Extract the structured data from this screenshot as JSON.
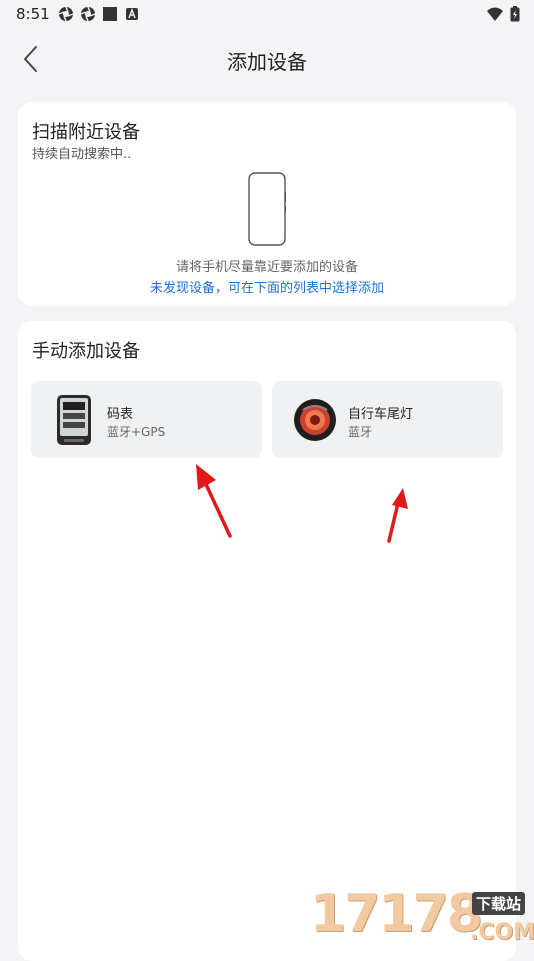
{
  "status_bar": {
    "time": "8:51"
  },
  "header": {
    "title": "添加设备"
  },
  "scan": {
    "title": "扫描附近设备",
    "subtitle": "持续自动搜索中..",
    "hint": "请将手机尽量靠近要添加的设备",
    "link": "未发现设备，可在下面的列表中选择添加"
  },
  "manual": {
    "title": "手动添加设备",
    "devices": [
      {
        "name": "码表",
        "type": "蓝牙+GPS",
        "icon": "bike-computer-icon"
      },
      {
        "name": "自行车尾灯",
        "type": "蓝牙",
        "icon": "tail-light-icon"
      }
    ]
  },
  "watermark": {
    "number": "17178",
    "suffix": "下载站",
    "domain": ".COM"
  },
  "colors": {
    "accent": "#1a73d9",
    "annotation": "#e01a1a"
  }
}
